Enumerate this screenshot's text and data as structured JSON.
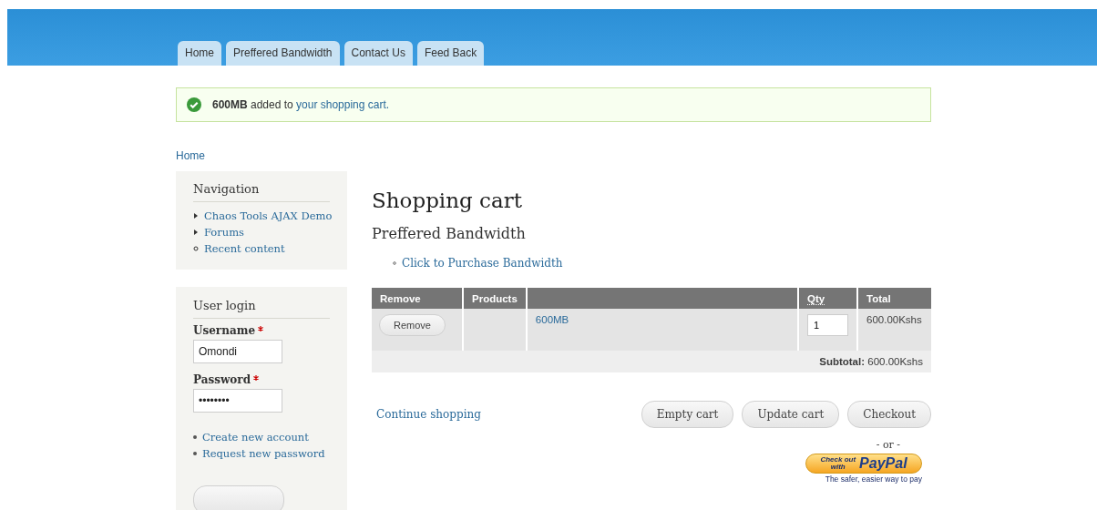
{
  "header": {
    "tabs": [
      {
        "label": "Home",
        "selected": false
      },
      {
        "label": "Preffered Bandwidth",
        "selected": false
      },
      {
        "label": "Contact Us",
        "selected": false
      },
      {
        "label": "Feed Back",
        "selected": false
      }
    ]
  },
  "message": {
    "kind": "success",
    "text": "**600MB** added to ",
    "link": "your shopping cart."
  },
  "breadcrumb": [
    "Home"
  ],
  "sidebar": {
    "navigation": {
      "title": "Navigation",
      "items": [
        {
          "label": "Chaos Tools AJAX Demo",
          "kind": "collapsed"
        },
        {
          "label": "Forums",
          "kind": "collapsed"
        },
        {
          "label": "Recent content",
          "kind": "leaf"
        }
      ]
    },
    "login": {
      "title": "User login",
      "fields": [
        {
          "label": "Username",
          "required": true,
          "value": "Omondi"
        },
        {
          "label": "Password",
          "required": true,
          "value": "••••••••"
        }
      ],
      "links": [
        "Create new account",
        "Request new password"
      ]
    }
  },
  "main": {
    "title": "Shopping cart",
    "subtitle": "Preffered Bandwidth",
    "links": [
      "Click to Purchase Bandwidth"
    ],
    "table": {
      "columns": [
        "Remove",
        "Products",
        "",
        "Qty",
        "Total"
      ],
      "rows": [
        {
          "remove_button": "Remove",
          "product": "600MB",
          "qty": "1",
          "total": "600.00Kshs"
        }
      ],
      "subtotal_label": "Subtotal:",
      "subtotal_value": "600.00Kshs"
    },
    "continue_link": "Continue shopping",
    "buttons": [
      "Empty cart",
      "Update cart",
      "Checkout"
    ],
    "or_text": "- or -",
    "paypal": {
      "line1": "Check out",
      "line2": "with",
      "brand": "PayPal",
      "tagline": "The safer, easier way to pay"
    }
  }
}
